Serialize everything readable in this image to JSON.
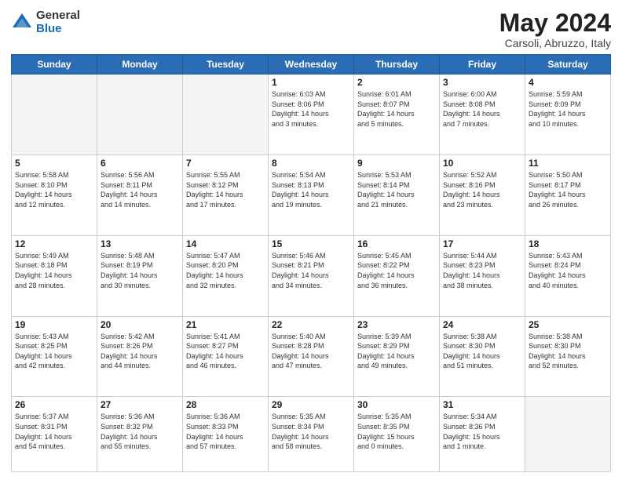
{
  "logo": {
    "general": "General",
    "blue": "Blue"
  },
  "title": {
    "month_year": "May 2024",
    "location": "Carsoli, Abruzzo, Italy"
  },
  "weekdays": [
    "Sunday",
    "Monday",
    "Tuesday",
    "Wednesday",
    "Thursday",
    "Friday",
    "Saturday"
  ],
  "weeks": [
    [
      {
        "day": "",
        "info": ""
      },
      {
        "day": "",
        "info": ""
      },
      {
        "day": "",
        "info": ""
      },
      {
        "day": "1",
        "info": "Sunrise: 6:03 AM\nSunset: 8:06 PM\nDaylight: 14 hours\nand 3 minutes."
      },
      {
        "day": "2",
        "info": "Sunrise: 6:01 AM\nSunset: 8:07 PM\nDaylight: 14 hours\nand 5 minutes."
      },
      {
        "day": "3",
        "info": "Sunrise: 6:00 AM\nSunset: 8:08 PM\nDaylight: 14 hours\nand 7 minutes."
      },
      {
        "day": "4",
        "info": "Sunrise: 5:59 AM\nSunset: 8:09 PM\nDaylight: 14 hours\nand 10 minutes."
      }
    ],
    [
      {
        "day": "5",
        "info": "Sunrise: 5:58 AM\nSunset: 8:10 PM\nDaylight: 14 hours\nand 12 minutes."
      },
      {
        "day": "6",
        "info": "Sunrise: 5:56 AM\nSunset: 8:11 PM\nDaylight: 14 hours\nand 14 minutes."
      },
      {
        "day": "7",
        "info": "Sunrise: 5:55 AM\nSunset: 8:12 PM\nDaylight: 14 hours\nand 17 minutes."
      },
      {
        "day": "8",
        "info": "Sunrise: 5:54 AM\nSunset: 8:13 PM\nDaylight: 14 hours\nand 19 minutes."
      },
      {
        "day": "9",
        "info": "Sunrise: 5:53 AM\nSunset: 8:14 PM\nDaylight: 14 hours\nand 21 minutes."
      },
      {
        "day": "10",
        "info": "Sunrise: 5:52 AM\nSunset: 8:16 PM\nDaylight: 14 hours\nand 23 minutes."
      },
      {
        "day": "11",
        "info": "Sunrise: 5:50 AM\nSunset: 8:17 PM\nDaylight: 14 hours\nand 26 minutes."
      }
    ],
    [
      {
        "day": "12",
        "info": "Sunrise: 5:49 AM\nSunset: 8:18 PM\nDaylight: 14 hours\nand 28 minutes."
      },
      {
        "day": "13",
        "info": "Sunrise: 5:48 AM\nSunset: 8:19 PM\nDaylight: 14 hours\nand 30 minutes."
      },
      {
        "day": "14",
        "info": "Sunrise: 5:47 AM\nSunset: 8:20 PM\nDaylight: 14 hours\nand 32 minutes."
      },
      {
        "day": "15",
        "info": "Sunrise: 5:46 AM\nSunset: 8:21 PM\nDaylight: 14 hours\nand 34 minutes."
      },
      {
        "day": "16",
        "info": "Sunrise: 5:45 AM\nSunset: 8:22 PM\nDaylight: 14 hours\nand 36 minutes."
      },
      {
        "day": "17",
        "info": "Sunrise: 5:44 AM\nSunset: 8:23 PM\nDaylight: 14 hours\nand 38 minutes."
      },
      {
        "day": "18",
        "info": "Sunrise: 5:43 AM\nSunset: 8:24 PM\nDaylight: 14 hours\nand 40 minutes."
      }
    ],
    [
      {
        "day": "19",
        "info": "Sunrise: 5:43 AM\nSunset: 8:25 PM\nDaylight: 14 hours\nand 42 minutes."
      },
      {
        "day": "20",
        "info": "Sunrise: 5:42 AM\nSunset: 8:26 PM\nDaylight: 14 hours\nand 44 minutes."
      },
      {
        "day": "21",
        "info": "Sunrise: 5:41 AM\nSunset: 8:27 PM\nDaylight: 14 hours\nand 46 minutes."
      },
      {
        "day": "22",
        "info": "Sunrise: 5:40 AM\nSunset: 8:28 PM\nDaylight: 14 hours\nand 47 minutes."
      },
      {
        "day": "23",
        "info": "Sunrise: 5:39 AM\nSunset: 8:29 PM\nDaylight: 14 hours\nand 49 minutes."
      },
      {
        "day": "24",
        "info": "Sunrise: 5:38 AM\nSunset: 8:30 PM\nDaylight: 14 hours\nand 51 minutes."
      },
      {
        "day": "25",
        "info": "Sunrise: 5:38 AM\nSunset: 8:30 PM\nDaylight: 14 hours\nand 52 minutes."
      }
    ],
    [
      {
        "day": "26",
        "info": "Sunrise: 5:37 AM\nSunset: 8:31 PM\nDaylight: 14 hours\nand 54 minutes."
      },
      {
        "day": "27",
        "info": "Sunrise: 5:36 AM\nSunset: 8:32 PM\nDaylight: 14 hours\nand 55 minutes."
      },
      {
        "day": "28",
        "info": "Sunrise: 5:36 AM\nSunset: 8:33 PM\nDaylight: 14 hours\nand 57 minutes."
      },
      {
        "day": "29",
        "info": "Sunrise: 5:35 AM\nSunset: 8:34 PM\nDaylight: 14 hours\nand 58 minutes."
      },
      {
        "day": "30",
        "info": "Sunrise: 5:35 AM\nSunset: 8:35 PM\nDaylight: 15 hours\nand 0 minutes."
      },
      {
        "day": "31",
        "info": "Sunrise: 5:34 AM\nSunset: 8:36 PM\nDaylight: 15 hours\nand 1 minute."
      },
      {
        "day": "",
        "info": ""
      }
    ]
  ]
}
